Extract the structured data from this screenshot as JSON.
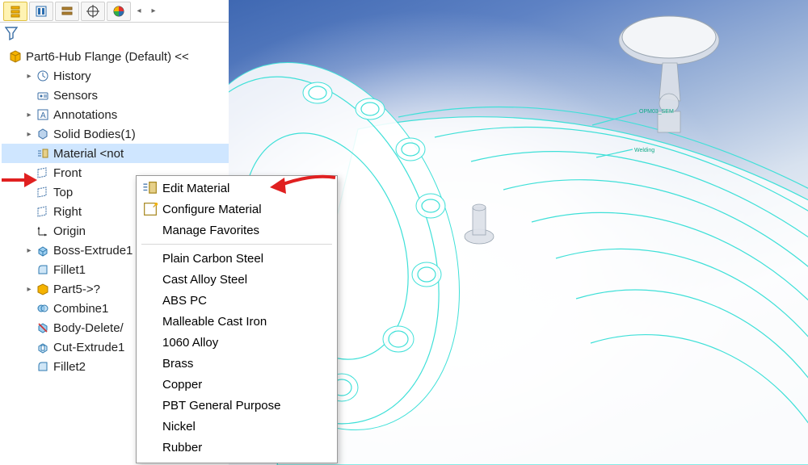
{
  "toolbar": {
    "buttons": [
      "feature-manager",
      "config",
      "display",
      "views",
      "appearance"
    ]
  },
  "tree": {
    "root": "Part6-Hub Flange (Default) <<",
    "items": [
      {
        "icon": "history-icon",
        "label": "History",
        "caret": true
      },
      {
        "icon": "sensors-icon",
        "label": "Sensors",
        "caret": false
      },
      {
        "icon": "annotations-icon",
        "label": "Annotations",
        "caret": true
      },
      {
        "icon": "solid-icon",
        "label": "Solid Bodies(1)",
        "caret": true
      },
      {
        "icon": "material-icon",
        "label": "Material <not",
        "caret": false,
        "selected": true
      },
      {
        "icon": "plane-icon",
        "label": "Front",
        "caret": false
      },
      {
        "icon": "plane-icon",
        "label": "Top",
        "caret": false
      },
      {
        "icon": "plane-icon",
        "label": "Right",
        "caret": false
      },
      {
        "icon": "origin-icon",
        "label": "Origin",
        "caret": false
      },
      {
        "icon": "extrude-icon",
        "label": "Boss-Extrude1",
        "caret": true
      },
      {
        "icon": "fillet-icon",
        "label": "Fillet1",
        "caret": false
      },
      {
        "icon": "part-icon",
        "label": "Part5->?",
        "caret": true
      },
      {
        "icon": "combine-icon",
        "label": "Combine1",
        "caret": false
      },
      {
        "icon": "bodydel-icon",
        "label": "Body-Delete/",
        "caret": false
      },
      {
        "icon": "cut-icon",
        "label": "Cut-Extrude1",
        "caret": false
      },
      {
        "icon": "fillet-icon",
        "label": "Fillet2",
        "caret": false
      }
    ]
  },
  "context_menu": {
    "edit": "Edit Material",
    "configure": "Configure Material",
    "manage": "Manage Favorites",
    "materials": [
      "Plain Carbon Steel",
      "Cast Alloy Steel",
      "ABS PC",
      "Malleable Cast Iron",
      "1060 Alloy",
      "Brass",
      "Copper",
      "PBT General Purpose",
      "Nickel",
      "Rubber"
    ]
  },
  "viewport": {
    "annotations": [
      "OPM03_SEM",
      "Welding"
    ]
  }
}
